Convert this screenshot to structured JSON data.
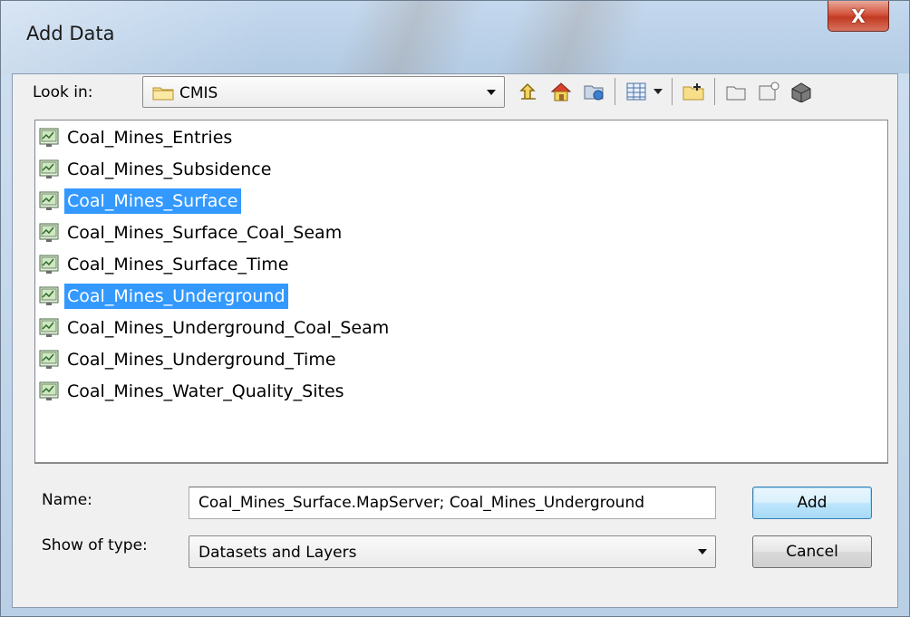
{
  "window": {
    "title": "Add Data",
    "close_glyph": "X"
  },
  "look_in": {
    "label": "Look in:",
    "value": "CMIS",
    "icon": "folder-icon"
  },
  "toolbar": {
    "icons": [
      "up-one-level-icon",
      "home-icon",
      "connect-folder-icon",
      "view-details-icon",
      "view-dropdown-icon",
      "new-folder-icon",
      "new-item-icon",
      "new-database-icon",
      "new-server-icon"
    ]
  },
  "files": [
    {
      "label": "Coal_Mines_Entries",
      "selected": false
    },
    {
      "label": "Coal_Mines_Subsidence",
      "selected": false
    },
    {
      "label": "Coal_Mines_Surface",
      "selected": true
    },
    {
      "label": "Coal_Mines_Surface_Coal_Seam",
      "selected": false
    },
    {
      "label": "Coal_Mines_Surface_Time",
      "selected": false
    },
    {
      "label": "Coal_Mines_Underground",
      "selected": true
    },
    {
      "label": "Coal_Mines_Underground_Coal_Seam",
      "selected": false
    },
    {
      "label": "Coal_Mines_Underground_Time",
      "selected": false
    },
    {
      "label": "Coal_Mines_Water_Quality_Sites",
      "selected": false
    }
  ],
  "name": {
    "label": "Name:",
    "value": "Coal_Mines_Surface.MapServer; Coal_Mines_Underground"
  },
  "type": {
    "label": "Show of type:",
    "value": "Datasets and Layers"
  },
  "buttons": {
    "add": "Add",
    "cancel": "Cancel"
  },
  "colors": {
    "selection": "#3399ff",
    "close": "#c23a22"
  }
}
